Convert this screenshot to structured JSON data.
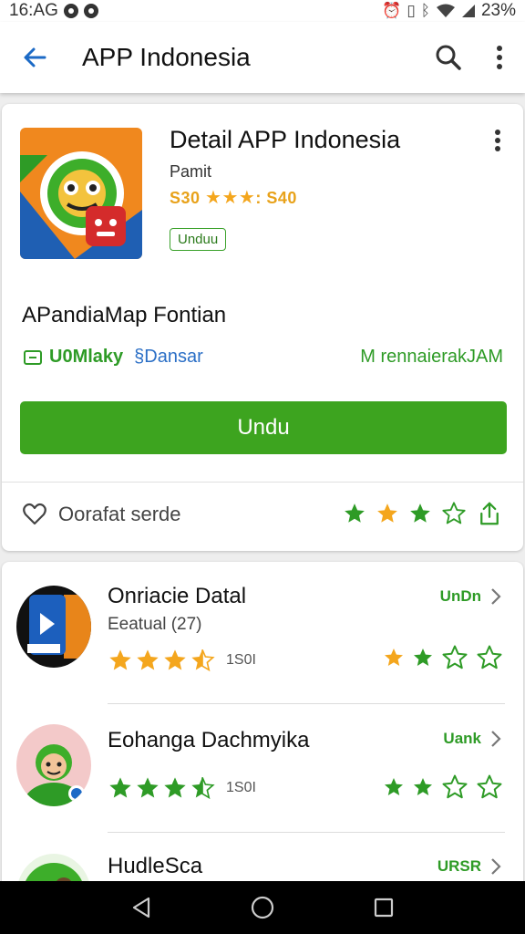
{
  "status_bar": {
    "time": "16:AG",
    "battery": "23%"
  },
  "app_bar": {
    "title": "APP Indonesia",
    "back_icon": "arrow-left-icon",
    "search_icon": "search-icon",
    "more_icon": "more-vert-icon"
  },
  "detail": {
    "title": "Detail APP Indonesia",
    "developer": "Pamit",
    "rating_left": "S30",
    "rating_right": "S40",
    "rating_stars": "★★★",
    "badge": "Unduu",
    "subtitle": "APandiaMap Fontian",
    "meta_left_label": "U0Mlaky",
    "meta_left_blue": "§Dansar",
    "meta_right": "M rennaierakJAM",
    "install_label": "Undu",
    "wishlist_label": "Oorafat serde",
    "star_pattern": [
      "full",
      "half-yellow",
      "full",
      "outline",
      "share"
    ]
  },
  "list": [
    {
      "title": "Onriacie Datal",
      "subtitle": "Eeatual (27)",
      "rating_count": "1S0I",
      "action": "UnDn",
      "stars": 3.5
    },
    {
      "title": "Eohanga Dachmyika",
      "subtitle": "",
      "rating_count": "1S0I",
      "action": "Uank",
      "stars": 3.5
    },
    {
      "title": "HudleSca",
      "subtitle": "",
      "rating_count": "",
      "action": "URSR",
      "stars": 0
    }
  ],
  "colors": {
    "accent": "#3da41f",
    "star_yellow": "#f4a61d",
    "star_green": "#2e9b26",
    "link_blue": "#2b6fc6"
  }
}
